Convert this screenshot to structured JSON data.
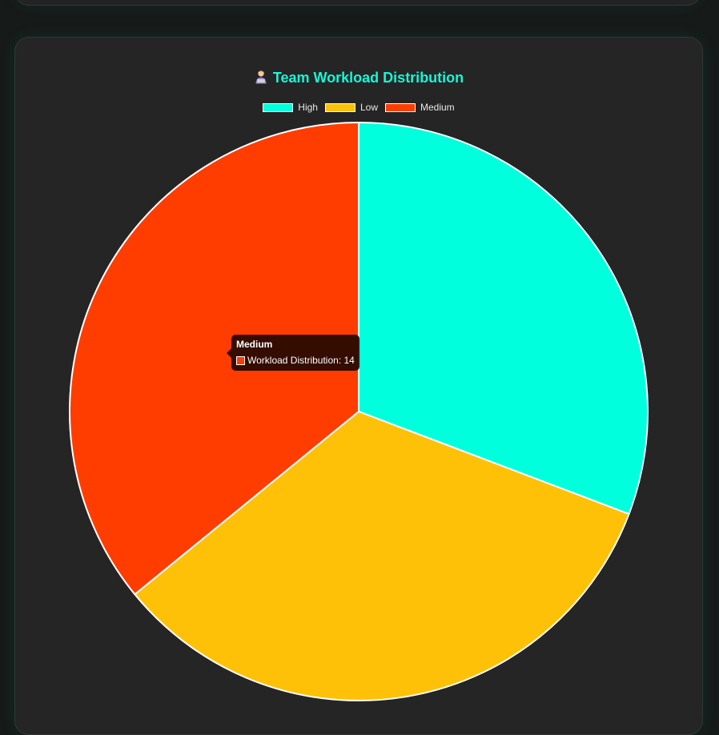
{
  "chart_data": {
    "type": "pie",
    "title": "Team Workload Distribution",
    "title_icon": "technologist-emoji-icon",
    "categories": [
      "High",
      "Low",
      "Medium"
    ],
    "series": [
      {
        "name": "Workload Distribution",
        "values": [
          12,
          13,
          14
        ]
      }
    ],
    "colors": [
      "#00FFDD",
      "#FFC107",
      "#FF3D00"
    ],
    "slice_border_color": "#FFFFFF",
    "legend_position": "top",
    "tooltip": {
      "title": "Medium",
      "label": "Workload Distribution: 14",
      "color": "#FF3D00"
    }
  }
}
